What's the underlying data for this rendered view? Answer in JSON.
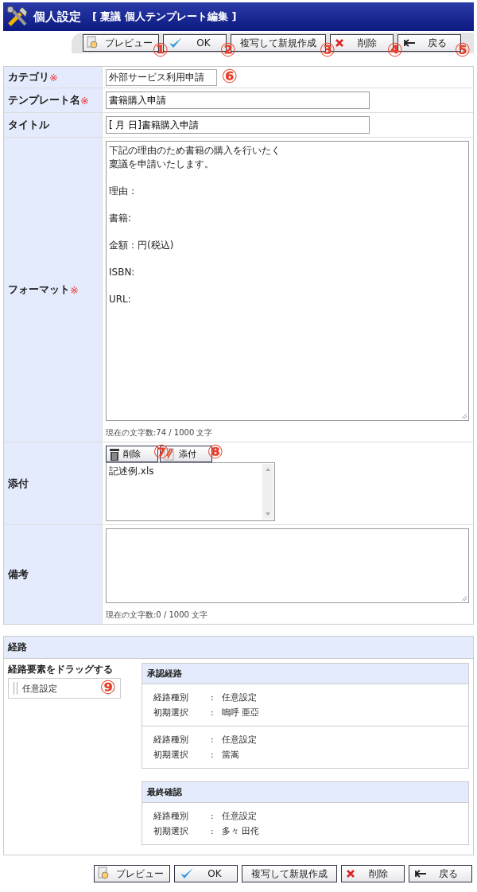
{
  "header": {
    "title": "個人設定",
    "subtitle": "[ 稟議 個人テンプレート編集 ]"
  },
  "toolbar": [
    {
      "kind": "preview",
      "label": "プレビュー",
      "callout": "①"
    },
    {
      "kind": "ok",
      "label": "OK",
      "callout": "②"
    },
    {
      "kind": "copy",
      "label": "複写して新規作成",
      "callout": "③"
    },
    {
      "kind": "delete",
      "label": "削除",
      "callout": "④"
    },
    {
      "kind": "back",
      "label": "戻る",
      "callout": "⑤"
    }
  ],
  "form": [
    {
      "kind": "select",
      "label": "カテゴリ",
      "required_mark": "※",
      "value": "外部サービス利用申請",
      "callout": "⑥"
    },
    {
      "kind": "text",
      "label": "テンプレート名",
      "required_mark": "※",
      "value": "書籍購入申請"
    },
    {
      "kind": "text",
      "label": "タイトル",
      "value": "[ 月 日]書籍購入申請"
    },
    {
      "kind": "textarea",
      "label": "フォーマット",
      "required_mark": "※",
      "lines": [
        {
          "text": "下記の理由のため書籍の購入を行いたく",
          "blank_before": false
        },
        {
          "text": "稟議を申請いたします。",
          "blank_before": false
        },
        {
          "text": "理由：",
          "blank_before": true
        },
        {
          "text": "書籍:",
          "blank_before": true
        },
        {
          "text": "金額：円(税込)",
          "blank_before": true
        },
        {
          "text": "ISBN:",
          "blank_before": true
        },
        {
          "text": "URL:",
          "blank_before": true
        }
      ],
      "counter": "現在の文字数:74 / 1000 文字"
    },
    {
      "kind": "attachment",
      "label": "添付",
      "buttons": [
        {
          "kind": "trash",
          "label": "削除",
          "callout": "⑦"
        },
        {
          "kind": "clip",
          "label": "添付",
          "callout": "⑧"
        }
      ],
      "files": [
        "記述例.xls"
      ]
    },
    {
      "kind": "remarks",
      "label": "備考",
      "counter": "現在の文字数:0 / 1000 文字"
    }
  ],
  "route": {
    "title": "経路",
    "palette_label": "経路要素をドラッグする",
    "palette_items": [
      {
        "label": "任意設定",
        "callout": "⑨"
      }
    ],
    "groups": [
      {
        "title": "承認経路",
        "steps": [
          [
            {
              "label": "経路種別",
              "separator": ":",
              "value": "任意設定"
            },
            {
              "label": "初期選択",
              "separator": ":",
              "value": "嗚呼 亜亞"
            }
          ],
          [
            {
              "label": "経路種別",
              "separator": ":",
              "value": "任意設定"
            },
            {
              "label": "初期選択",
              "separator": ":",
              "value": "當嵩"
            }
          ]
        ]
      },
      {
        "title": "最終確認",
        "steps": [
          [
            {
              "label": "経路種別",
              "separator": ":",
              "value": "任意設定"
            },
            {
              "label": "初期選択",
              "separator": ":",
              "value": "多々 田侘"
            }
          ]
        ]
      }
    ]
  },
  "bottom_bar": [
    {
      "kind": "preview",
      "label": "プレビュー"
    },
    {
      "kind": "ok",
      "label": "OK"
    },
    {
      "kind": "copy",
      "label": "複写して新規作成"
    },
    {
      "kind": "delete",
      "label": "削除"
    },
    {
      "kind": "back",
      "label": "戻る"
    }
  ]
}
